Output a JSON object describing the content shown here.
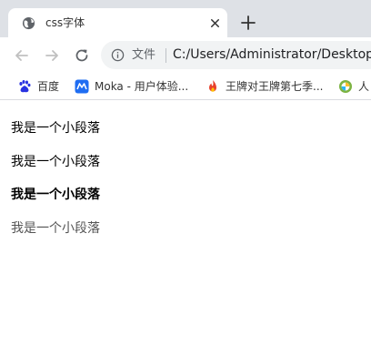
{
  "tab": {
    "title": "css字体",
    "icon": "globe-icon"
  },
  "toolbar": {
    "back_icon": "arrow-left-icon",
    "forward_icon": "arrow-right-icon",
    "reload_icon": "reload-icon",
    "security_label": "文件",
    "url": "C:/Users/Administrator/Desktop/"
  },
  "bookmarks": [
    {
      "label": "百度",
      "icon": "baidu-paw-icon",
      "color": "#2932e1"
    },
    {
      "label": "Moka - 用户体验...",
      "icon": "moka-icon",
      "color": "#1f6df2"
    },
    {
      "label": "王牌对王牌第七季...",
      "icon": "flame-icon",
      "color": "#e8412c"
    },
    {
      "label": "人",
      "icon": "pinwheel-icon",
      "color": "#7cb342"
    }
  ],
  "content": {
    "paragraphs": [
      "我是一个小段落",
      "我是一个小段落",
      "我是一个小段落",
      "我是一个小段落"
    ]
  },
  "colors": {
    "tabstrip": "#dee1e6",
    "omnibox": "#f1f3f4",
    "faded_text": "#555555"
  }
}
